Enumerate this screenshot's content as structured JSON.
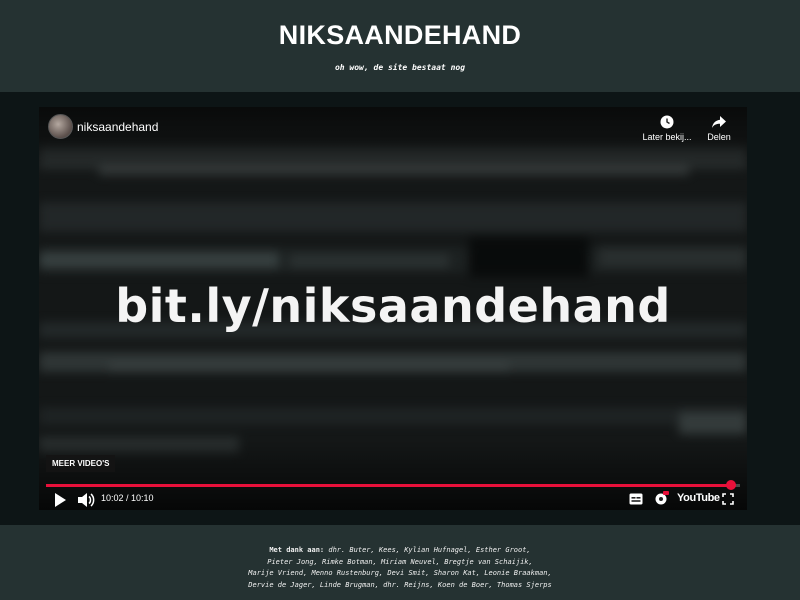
{
  "header": {
    "title": "NIKSAANDEHAND",
    "subtitle": "oh wow, de site bestaat nog"
  },
  "player": {
    "channel_name": "niksaandehand",
    "overlay_text": "bit.ly/niksaandehand",
    "watch_later_label": "Later bekij...",
    "share_label": "Delen",
    "more_videos_label": "MEER VIDEO'S",
    "time_display": "10:02 / 10:10",
    "progress": 0.987,
    "youtube_label": "YouTube",
    "accent_color": "#e8103a",
    "icons": [
      "play-icon",
      "volume-icon",
      "subtitles-icon",
      "settings-icon",
      "fullscreen-icon",
      "clock-icon",
      "share-icon"
    ]
  },
  "footer": {
    "credits_lead": "Met dank aan:",
    "credits_lines": [
      "dhr. Buter, Kees, Kylian Hufnagel, Esther Groot,",
      "Pieter Jong, Rimke Botman, Miriam Neuvel, Bregtje van Schaijik,",
      "Marije Vriend, Menno Rustenburg, Devi Smit, Sharon Kat, Leonie Braakman,",
      "Dervie de Jager, Linde Brugman, dhr. Reijns, Koen de Boer, Thomas Sjerps"
    ]
  }
}
